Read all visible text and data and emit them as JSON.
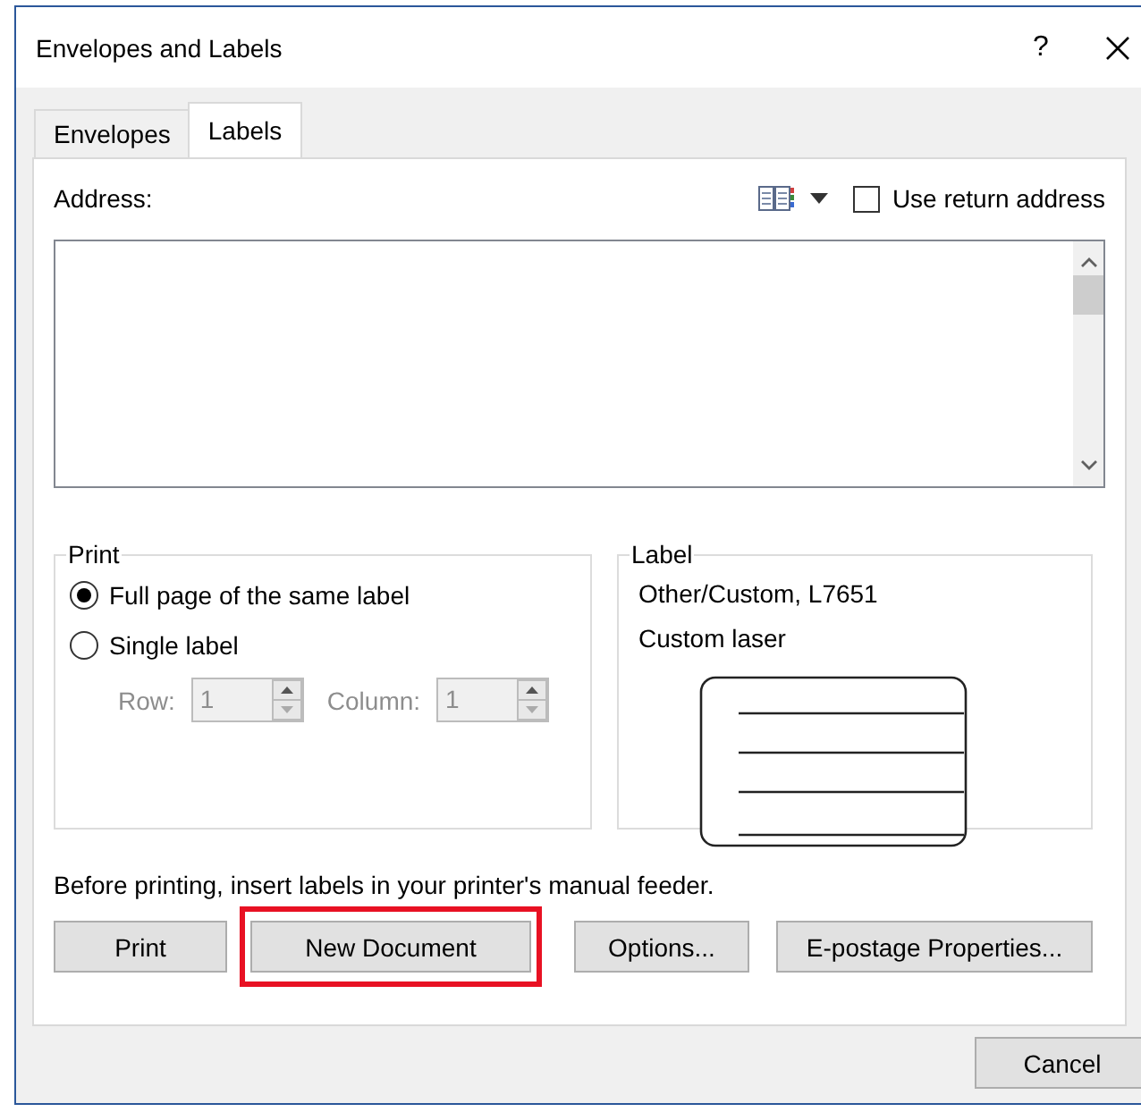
{
  "window": {
    "title": "Envelopes and Labels",
    "help": "?"
  },
  "tabs": [
    {
      "label": "Envelopes",
      "selected": false
    },
    {
      "label": "Labels",
      "selected": true
    }
  ],
  "address": {
    "label": "Address:"
  },
  "use_return_address": {
    "label": "Use return address",
    "checked": false
  },
  "print_group": {
    "title": "Print",
    "options": [
      {
        "label": "Full page of the same label",
        "selected": true
      },
      {
        "label": "Single label",
        "selected": false
      }
    ],
    "row": {
      "label": "Row:",
      "value": "1",
      "disabled": true
    },
    "column": {
      "label": "Column:",
      "value": "1",
      "disabled": true
    }
  },
  "label_group": {
    "title": "Label",
    "lines": [
      "Other/Custom, L7651",
      "Custom laser"
    ]
  },
  "note": "Before printing, insert labels in your printer's manual feeder.",
  "buttons": [
    {
      "label": "Print",
      "highlighted": false
    },
    {
      "label": "New Document",
      "highlighted": true
    },
    {
      "label": "Options...",
      "highlighted": false
    },
    {
      "label": "E-postage Properties...",
      "highlighted": false
    }
  ],
  "cancel": "Cancel"
}
